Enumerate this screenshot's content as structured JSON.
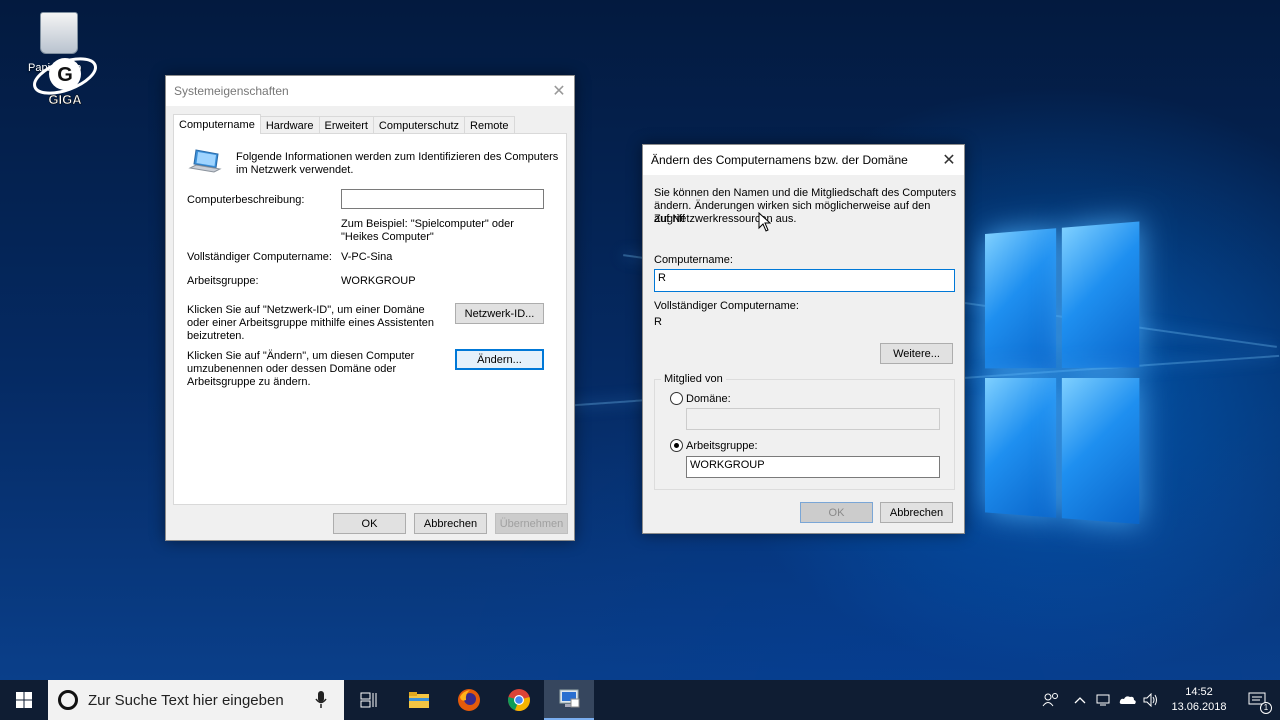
{
  "desktop": {
    "recycle_bin_label": "Papierkorb",
    "watermark": "GIGA"
  },
  "sysprops": {
    "title": "Systemeigenschaften",
    "tabs": [
      "Computername",
      "Hardware",
      "Erweitert",
      "Computerschutz",
      "Remote"
    ],
    "active_tab": "Computername",
    "intro_line1": "Folgende Informationen werden zum Identifizieren des Computers",
    "intro_line2": "im Netzwerk verwendet.",
    "description_label": "Computerbeschreibung:",
    "description_value": "",
    "example_line1": "Zum Beispiel: \"Spielcomputer\" oder",
    "example_line2": "\"Heikes Computer\"",
    "fullname_label": "Vollständiger Computername:",
    "fullname_value": "V-PC-Sina",
    "workgroup_label": "Arbeitsgruppe:",
    "workgroup_value": "WORKGROUP",
    "netid_text1": "Klicken Sie auf \"Netzwerk-ID\", um einer Domäne",
    "netid_text2": "oder einer Arbeitsgruppe mithilfe eines Assistenten",
    "netid_text3": "beizutreten.",
    "netid_button": "Netzwerk-ID...",
    "change_text1": "Klicken Sie auf \"Ändern\", um diesen Computer",
    "change_text2": "umzubenennen oder dessen Domäne oder",
    "change_text3": "Arbeitsgruppe zu ändern.",
    "change_button": "Ändern...",
    "ok": "OK",
    "cancel": "Abbrechen",
    "apply": "Übernehmen"
  },
  "rename": {
    "title": "Ändern des Computernamens bzw. der Domäne",
    "info_line1": "Sie können den Namen und die Mitgliedschaft des Computers",
    "info_line2": "ändern. Änderungen wirken sich möglicherweise auf den Zugriff",
    "info_line3": "auf Netzwerkressourcen aus.",
    "computername_label": "Computername:",
    "computername_value": "R",
    "fullname_label": "Vollständiger Computername:",
    "fullname_value": "R",
    "more_button": "Weitere...",
    "member_group_label": "Mitglied von",
    "domain_label": "Domäne:",
    "domain_value": "",
    "workgroup_label": "Arbeitsgruppe:",
    "workgroup_value": "WORKGROUP",
    "selected_membership": "Arbeitsgruppe",
    "ok": "OK",
    "cancel": "Abbrechen"
  },
  "taskbar": {
    "search_placeholder": "Zur Suche Text hier eingeben",
    "pinned": [
      "task-view-icon",
      "file-explorer-icon",
      "firefox-icon",
      "chrome-icon",
      "system-properties-icon"
    ],
    "time": "14:52",
    "date": "13.06.2018",
    "notification_count": "1"
  }
}
